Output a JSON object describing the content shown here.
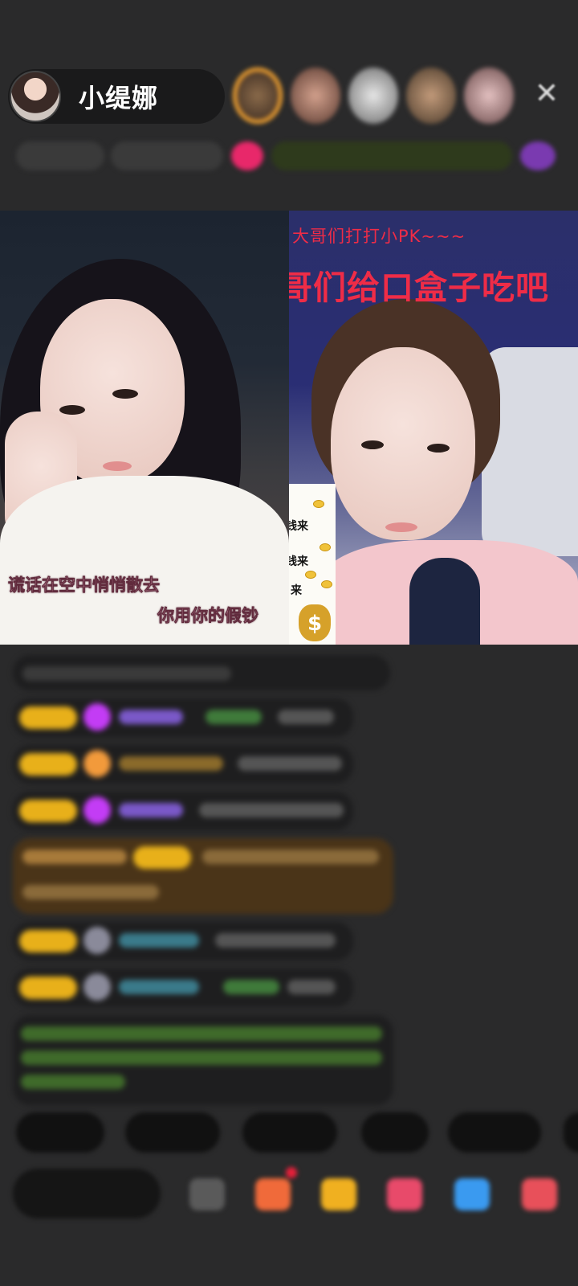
{
  "host": {
    "name": "小缇娜"
  },
  "stream": {
    "left_lyric_line1": "谎话在空中悄悄散去",
    "left_lyric_line2": "你用你的假钞",
    "pk_banner_line1": "大哥们打打小PK~~~",
    "pk_banner_line2": "哥们给口盒子吃吧",
    "money_card": {
      "lines": [
        "钱来",
        "钱来",
        "来"
      ],
      "symbol": "$"
    }
  },
  "colors": {
    "background": "#2a2a2b",
    "pk_text": "#ef2c47",
    "lyric_text": "#f3b3c8",
    "badge": "#e8b01a",
    "gift_purple": "#c33cf5",
    "gift_orange": "#f29a3b"
  },
  "icons": {
    "close": "close-icon",
    "gift": "gift-icon"
  }
}
